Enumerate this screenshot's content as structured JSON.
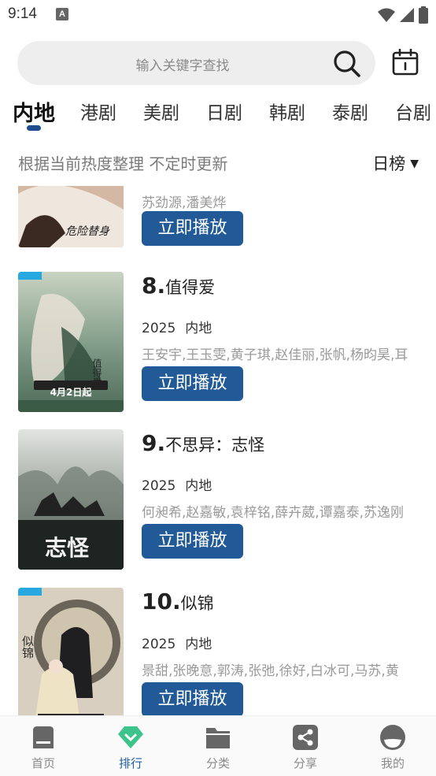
{
  "status_bar": {
    "time": "9:14",
    "app_badge": "A"
  },
  "search": {
    "placeholder": "输入关键字查找"
  },
  "tabs": [
    {
      "label": "内地",
      "active": true
    },
    {
      "label": "港剧"
    },
    {
      "label": "美剧"
    },
    {
      "label": "日剧"
    },
    {
      "label": "韩剧"
    },
    {
      "label": "泰剧"
    },
    {
      "label": "台剧"
    }
  ],
  "subheader": {
    "description": "根据当前热度整理 不定时更新",
    "rank_type": "日榜"
  },
  "list": [
    {
      "rank": "",
      "title": "",
      "year": "",
      "region": "",
      "cast": "苏劲源,潘美烨",
      "play_label": "立即播放",
      "poster_text": "危险替身"
    },
    {
      "rank": "8.",
      "title": "值得爱",
      "year": "2025",
      "region": "内地",
      "cast": "王安宇,王玉雯,黄子琪,赵佳丽,张帆,杨昀昊,耳",
      "play_label": "立即播放",
      "poster_text": "值得爱",
      "poster_date": "4月2日起"
    },
    {
      "rank": "9.",
      "title": "不思异：志怪",
      "year": "2025",
      "region": "内地",
      "cast": "何昶希,赵嘉敏,袁梓铭,薛卉葳,谭嘉泰,苏逸刚",
      "play_label": "立即播放",
      "poster_text": "志怪"
    },
    {
      "rank": "10.",
      "title": "似锦",
      "year": "2025",
      "region": "内地",
      "cast": "景甜,张晚意,郭涛,张弛,徐好,白冰可,马苏,黄",
      "play_label": "立即播放",
      "poster_text": "似锦"
    }
  ],
  "bottom_nav": [
    {
      "label": "首页",
      "icon": "home-icon"
    },
    {
      "label": "排行",
      "icon": "ranking-icon",
      "active": true
    },
    {
      "label": "分类",
      "icon": "folder-icon"
    },
    {
      "label": "分享",
      "icon": "share-icon"
    },
    {
      "label": "我的",
      "icon": "profile-icon"
    }
  ],
  "colors": {
    "accent": "#215a96",
    "active_nav": "#1f5ea0",
    "ranking_icon": "#3cc48c"
  }
}
